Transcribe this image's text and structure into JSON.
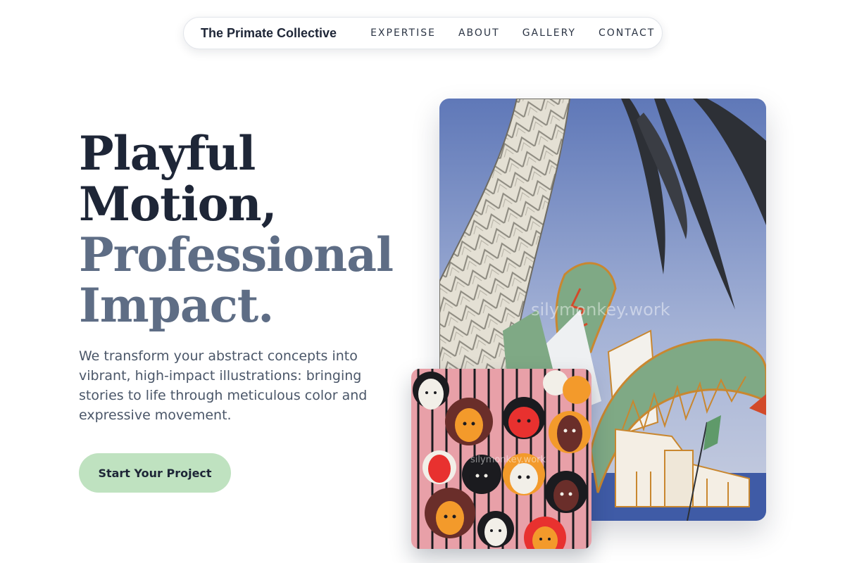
{
  "nav": {
    "brand": "The Primate Collective",
    "links": [
      "EXPERTISE",
      "ABOUT",
      "GALLERY",
      "CONTACT"
    ]
  },
  "hero": {
    "headline_line1": "Playful",
    "headline_line2": "Motion,",
    "headline_line3": "Professional",
    "headline_line4": "Impact.",
    "lead": "We transform your abstract concepts into vibrant, high-impact illustrations: bringing stories to life through meticulous color and expressive movement.",
    "cta_label": "Start Your Project"
  },
  "gallery": {
    "main_watermark": "silymonkey.work",
    "small_watermark": "silymonkey.work"
  },
  "colors": {
    "headline_dark": "#1e2637",
    "headline_slate": "#5e6d85",
    "cta_bg": "#bfe2c0",
    "sky": "#6f86c4",
    "leaf_green": "#7fa985"
  }
}
